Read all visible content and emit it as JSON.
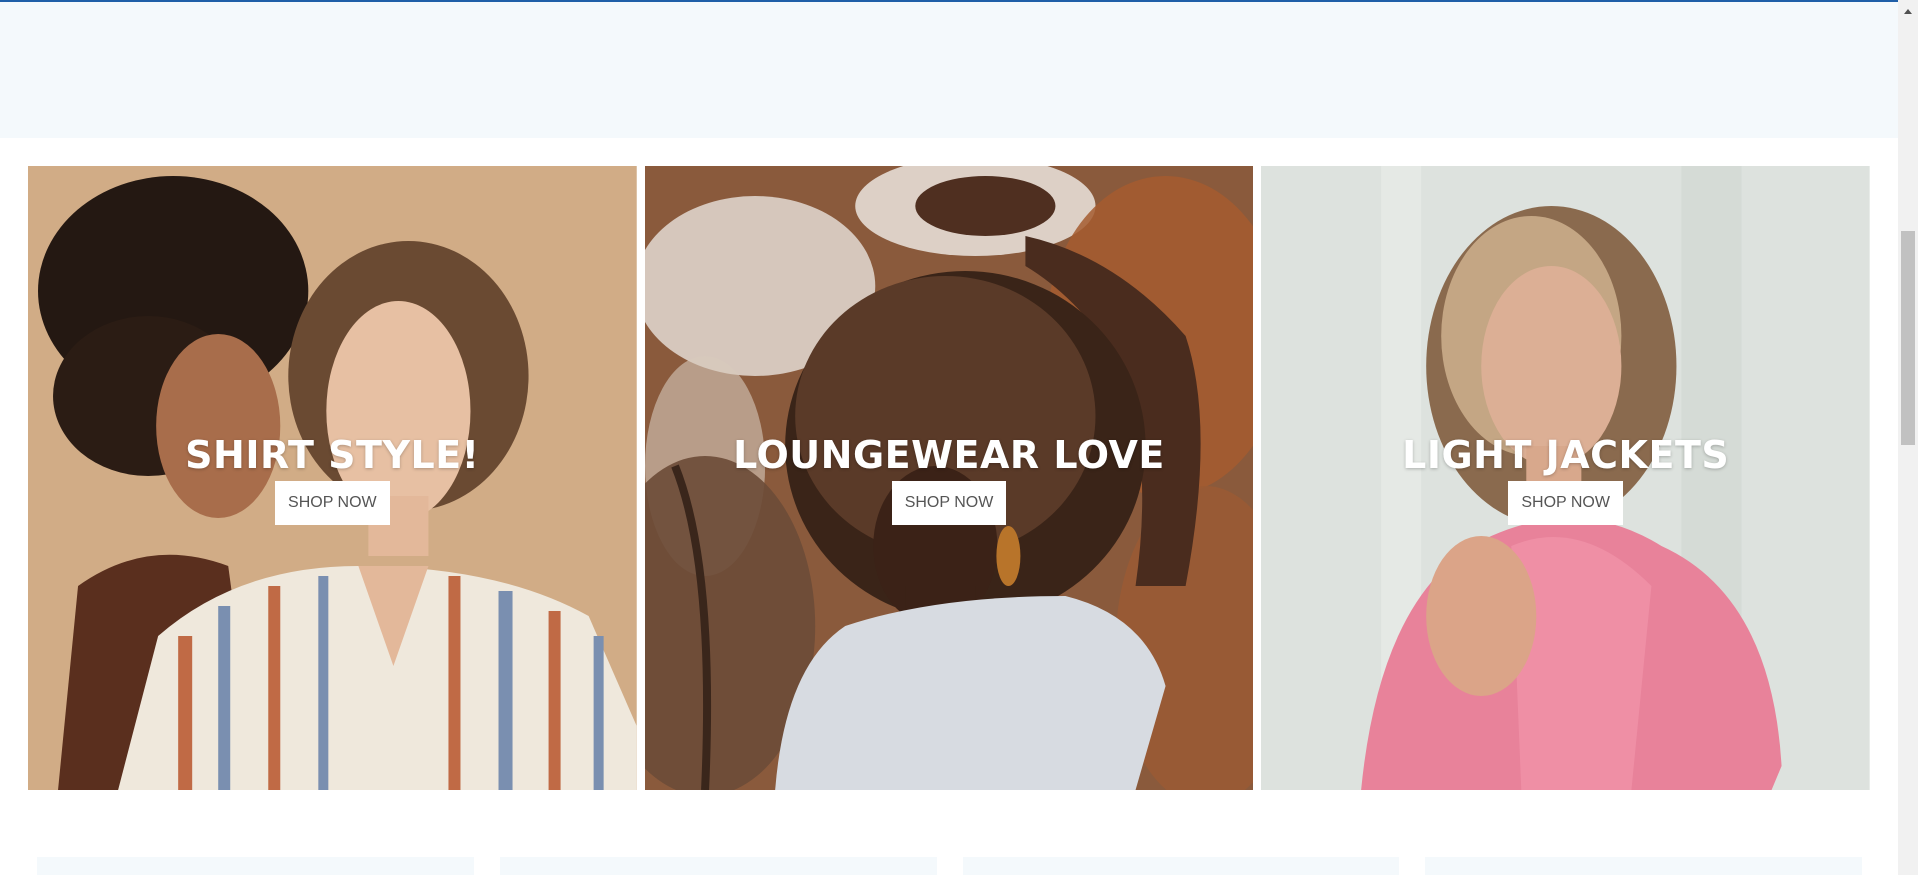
{
  "promos": [
    {
      "title": "SHIRT STYLE!",
      "cta": "SHOP NOW",
      "photo": "two-models-striped-shirt"
    },
    {
      "title": "LOUNGEWEAR LOVE",
      "cta": "SHOP NOW",
      "photo": "model-white-tee-autumn-trees"
    },
    {
      "title": "LIGHT JACKETS",
      "cta": "SHOP NOW",
      "photo": "model-pink-jacket"
    }
  ],
  "colors": {
    "accent_line": "#1f5fa8",
    "band_background": "#f4f9fc",
    "title_text": "#ffffff",
    "button_background": "#ffffff",
    "button_text": "#555555"
  },
  "scrollbar": {
    "up_icon": "scroll-up-arrow-icon"
  }
}
